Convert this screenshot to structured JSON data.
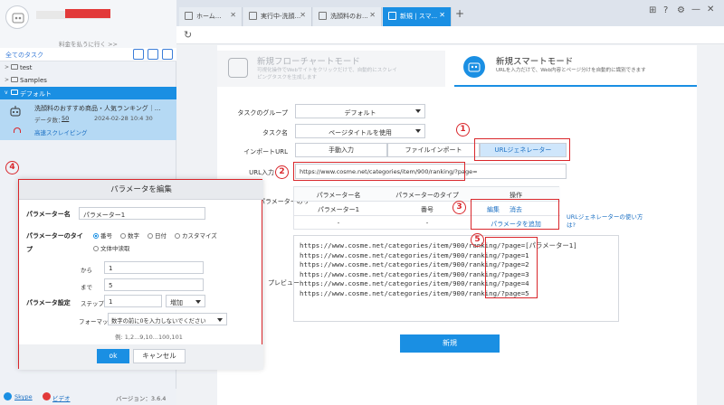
{
  "sidebar": {
    "upgrade_link": "料金を払うに行く >>",
    "all_tasks_label": "全てのタスク",
    "folders": [
      {
        "label": "test"
      },
      {
        "label": "Samples"
      },
      {
        "label": "デフォルト"
      }
    ],
    "task": {
      "title": "洗顔料のおすすめ商品・人気ランキング｜...",
      "data_count_label": "データ数：",
      "data_count": "50",
      "date": "2024-02-28 10:4 30",
      "speed_label": "高速スクレイピング"
    },
    "footer": {
      "skype": "Skype",
      "video": "ビデオ",
      "version": "バージョン：3.6.4"
    }
  },
  "tabs": [
    {
      "label": "ホーム..."
    },
    {
      "label": "実行中-洗顔..."
    },
    {
      "label": "洗顔料のお..."
    },
    {
      "label": "新規 | スマ..."
    }
  ],
  "modes": {
    "flowchart": {
      "title": "新規フローチャートモード",
      "sub": "可視化操作でWebサイトをクリックだけで、自動的にスクレイピングタスクを生成します"
    },
    "smart": {
      "title": "新規スマートモード",
      "sub": "URLを入力だけで、Web内容とページ分けを自動的に識別できます"
    }
  },
  "form": {
    "group_label": "タスクのグループ",
    "group_value": "デフォルト",
    "name_label": "タスク名",
    "name_value": "ページタイトルを使用",
    "import_label": "インポートURL",
    "import_manual": "手動入力",
    "import_file": "ファイルインポート",
    "import_generator": "URLジェネレーター",
    "url_label": "URL入力",
    "url_value": "https://www.cosme.net/categories/item/900/ranking/?page=",
    "list_label": "パラメーターのリ",
    "preview_label": "プレビュー",
    "create_button": "新規",
    "help_link": "URLジェネレーターの使い方は?"
  },
  "param_table": {
    "headers": [
      "パラメーター名",
      "パラメーターのタイプ",
      "操作"
    ],
    "rows": [
      {
        "name": "パラメーター1",
        "type": "番号",
        "edit": "編集",
        "delete": "消去"
      },
      {
        "name": "-",
        "type": "-",
        "add": "パラメータを追加"
      }
    ]
  },
  "preview": {
    "base": "https://www.cosme.net/categories/item/900/ranking/",
    "lines": [
      "?page=[パラメーター1]",
      "?page=1",
      "?page=2",
      "?page=3",
      "?page=4",
      "?page=5"
    ]
  },
  "annotations": [
    "1",
    "2",
    "3",
    "4",
    "5"
  ],
  "modal": {
    "title": "パラメータを編集",
    "name_label": "パラメーター名",
    "name_value": "パラメーター1",
    "type_label_1": "パラメーターのタイ",
    "type_label_2": "プ",
    "types": [
      "番号",
      "数字",
      "日付",
      "カスタマイズ",
      "文体中读取"
    ],
    "from_label": "から",
    "from_value": "1",
    "to_label": "まで",
    "to_value": "5",
    "settings_label": "パラメータ設定",
    "step_label": "ステップ",
    "step_value": "1",
    "step_mode": "増加",
    "format_label": "フォーマット",
    "format_value": "数字の前に0を入力しないでください",
    "example": "例: 1,2...9,10...100,101",
    "ok": "ok",
    "cancel": "キャンセル"
  },
  "colors": {
    "accent": "#1a8fe3",
    "highlight": "#d9262b",
    "selection": "#b5d9f4"
  }
}
